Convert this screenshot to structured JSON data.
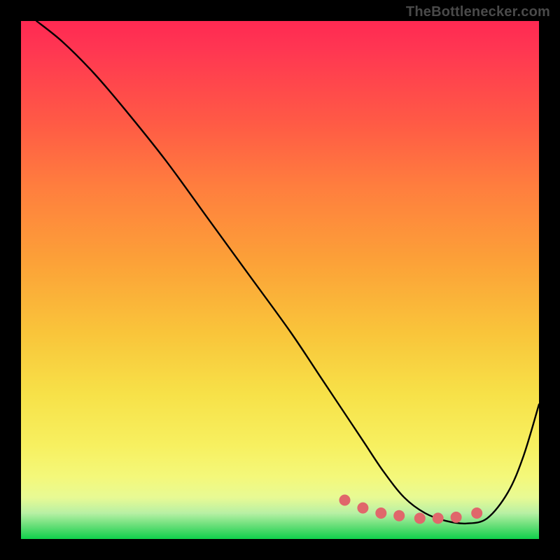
{
  "attribution": "TheBottlenecker.com",
  "chart_data": {
    "type": "line",
    "title": "",
    "xlabel": "",
    "ylabel": "",
    "xlim": [
      0,
      1
    ],
    "ylim": [
      0,
      1
    ],
    "series": [
      {
        "name": "curve",
        "x": [
          0.03,
          0.08,
          0.14,
          0.2,
          0.28,
          0.36,
          0.44,
          0.52,
          0.58,
          0.62,
          0.66,
          0.7,
          0.74,
          0.78,
          0.82,
          0.86,
          0.9,
          0.94,
          0.97,
          1.0
        ],
        "values": [
          1.0,
          0.96,
          0.9,
          0.83,
          0.73,
          0.62,
          0.51,
          0.4,
          0.31,
          0.25,
          0.19,
          0.13,
          0.08,
          0.05,
          0.035,
          0.03,
          0.04,
          0.09,
          0.16,
          0.26
        ]
      },
      {
        "name": "dots",
        "x": [
          0.625,
          0.66,
          0.695,
          0.73,
          0.77,
          0.805,
          0.84,
          0.88
        ],
        "values": [
          0.075,
          0.06,
          0.05,
          0.045,
          0.04,
          0.04,
          0.042,
          0.05
        ]
      }
    ],
    "colors": {
      "curve_stroke": "#000000",
      "dot_fill": "#e0676b"
    }
  }
}
